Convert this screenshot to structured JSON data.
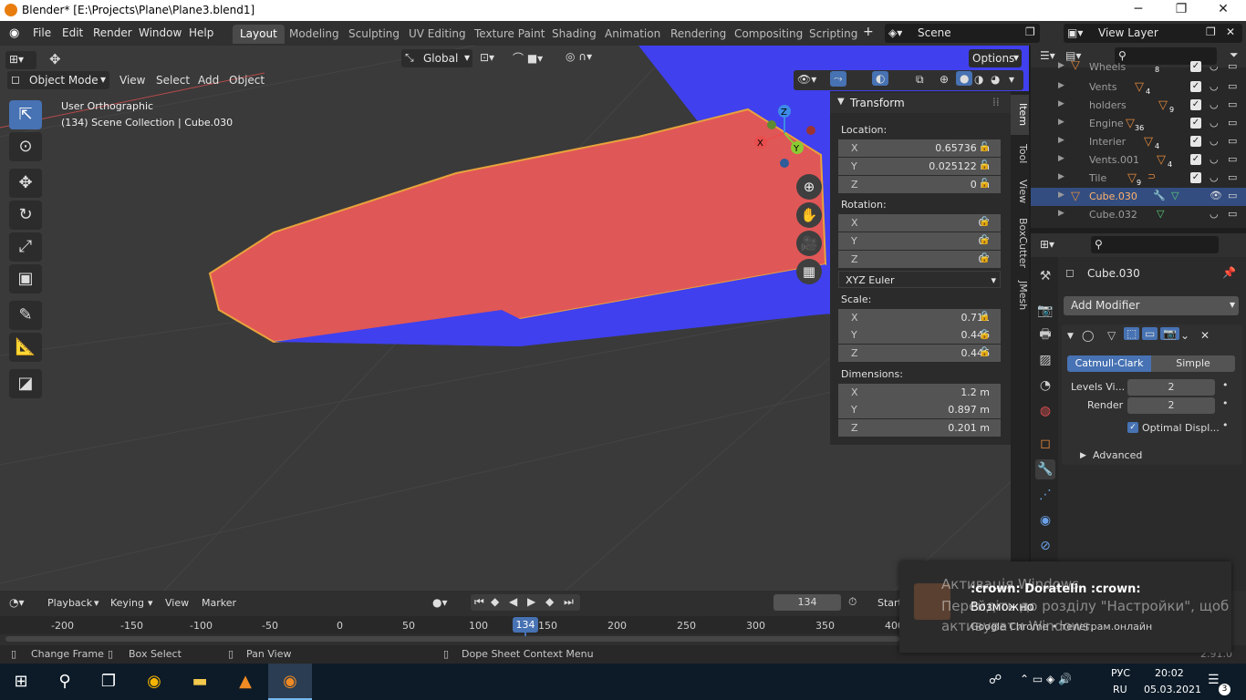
{
  "window": {
    "title": "Blender* [E:\\Projects\\Plane\\Plane3.blend1]",
    "min": "─",
    "max": "❐",
    "close": "✕"
  },
  "menu": [
    "File",
    "Edit",
    "Render",
    "Window",
    "Help"
  ],
  "workspaces": [
    "Layout",
    "Modeling",
    "Sculpting",
    "UV Editing",
    "Texture Paint",
    "Shading",
    "Animation",
    "Rendering",
    "Compositing",
    "Scripting"
  ],
  "active_workspace": "Layout",
  "scene": {
    "label": "Scene",
    "view_layer": "View Layer"
  },
  "viewport": {
    "mode": "Object Mode",
    "menus": [
      "View",
      "Select",
      "Add",
      "Object"
    ],
    "orientation": "Global",
    "options": "Options",
    "overlay_title": "User Orthographic",
    "overlay_sub": "(134) Scene Collection | Cube.030",
    "colors": {
      "bg": "#3a3a3a",
      "red": "#e05757",
      "blue": "#4040ee",
      "outline": "#e8a23c"
    }
  },
  "npanel": {
    "header": "Transform",
    "location_label": "Location:",
    "location": [
      {
        "ax": "X",
        "v": "0.65736 m"
      },
      {
        "ax": "Y",
        "v": "0.025122 m"
      },
      {
        "ax": "Z",
        "v": "0 m"
      }
    ],
    "rotation_label": "Rotation:",
    "rotation": [
      {
        "ax": "X",
        "v": "0°"
      },
      {
        "ax": "Y",
        "v": "0°"
      },
      {
        "ax": "Z",
        "v": "0°"
      }
    ],
    "rotation_mode": "XYZ Euler",
    "scale_label": "Scale:",
    "scale": [
      {
        "ax": "X",
        "v": "0.711"
      },
      {
        "ax": "Y",
        "v": "0.446"
      },
      {
        "ax": "Z",
        "v": "0.446"
      }
    ],
    "dimensions_label": "Dimensions:",
    "dimensions": [
      {
        "ax": "X",
        "v": "1.2 m"
      },
      {
        "ax": "Y",
        "v": "0.897 m"
      },
      {
        "ax": "Z",
        "v": "0.201 m"
      }
    ],
    "tabs": [
      "Item",
      "Tool",
      "View",
      "BoxCutter",
      "JMesh"
    ]
  },
  "outliner": {
    "rows": [
      {
        "name": "Wheels",
        "count": "8",
        "selected": false
      },
      {
        "name": "Vents",
        "count": "4",
        "selected": false
      },
      {
        "name": "holders",
        "count": "9",
        "selected": false
      },
      {
        "name": "Engine",
        "count": "36",
        "selected": false
      },
      {
        "name": "Interier",
        "count": "4",
        "selected": false
      },
      {
        "name": "Vents.001",
        "count": "4",
        "selected": false
      },
      {
        "name": "Tile",
        "count": "9",
        "selected": false
      },
      {
        "name": "Cube.030",
        "count": "",
        "selected": true
      },
      {
        "name": "Cube.032",
        "count": "",
        "selected": false
      }
    ]
  },
  "properties": {
    "object": "Cube.030",
    "add_modifier": "Add Modifier",
    "subdiv_tabs": [
      "Catmull-Clark",
      "Simple"
    ],
    "levels_label": "Levels Vi...",
    "levels": "2",
    "render_label": "Render",
    "render": "2",
    "optimal": "Optimal Displ...",
    "advanced": "Advanced"
  },
  "timeline": {
    "menus": [
      "Playback",
      "Keying",
      "View",
      "Marker"
    ],
    "frame": "134",
    "start": "Start",
    "ticks": [
      "-200",
      "-150",
      "-100",
      "-50",
      "0",
      "50",
      "100",
      "150",
      "200",
      "250",
      "300",
      "350",
      "400"
    ],
    "current": "134"
  },
  "status": {
    "items": [
      "Change Frame",
      "Box Select",
      "Pan View",
      "Dope Sheet Context Menu"
    ],
    "version": "2.91.0"
  },
  "notification": {
    "title": ":crown: Doratelin :crown:",
    "body": "Возможно",
    "source": "Google Chrome • телеграм.онлайн",
    "watermark1": "Активація Windows",
    "watermark2": "Перейдіть до розділу \"Настройки\", щоб",
    "watermark3": "активувати Windows."
  },
  "taskbar": {
    "lang": "РУС",
    "lang2": "RU",
    "time": "20:02",
    "date": "05.03.2021",
    "badge": "3"
  }
}
